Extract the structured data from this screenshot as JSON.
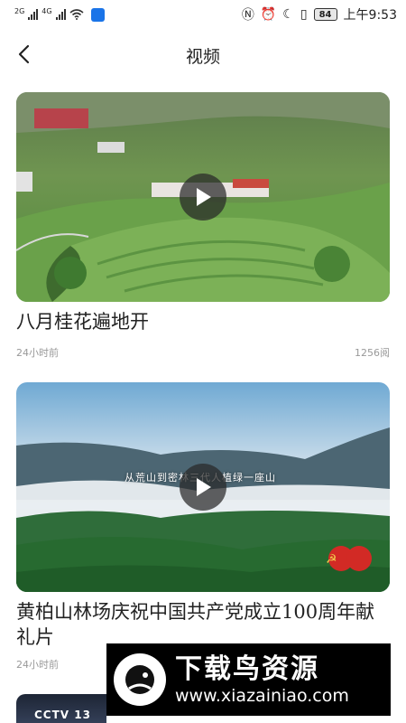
{
  "status_bar": {
    "net_left": "2G",
    "net_right": "4G",
    "battery": "84",
    "time": "上午9:53",
    "icons": [
      "nfc-icon",
      "alarm-icon",
      "moon-icon",
      "vibrate-icon"
    ]
  },
  "nav": {
    "title": "视频",
    "back_icon": "chevron-left-icon"
  },
  "videos": [
    {
      "title": "八月桂花遍地开",
      "time_ago": "24小时前",
      "views": "1256阅"
    },
    {
      "title": "黄柏山林场庆祝中国共产党成立100周年献礼片",
      "time_ago": "24小时前",
      "overlay_caption": "从荒山到密林三代人植绿一座山"
    }
  ],
  "watermark": {
    "name": "下载鸟资源",
    "url": "www.xiazainiao.com"
  },
  "third_card": {
    "logo": "CCTV 13"
  },
  "colors": {
    "text": "#222222",
    "meta": "#999999",
    "play_bg": "#282828"
  }
}
